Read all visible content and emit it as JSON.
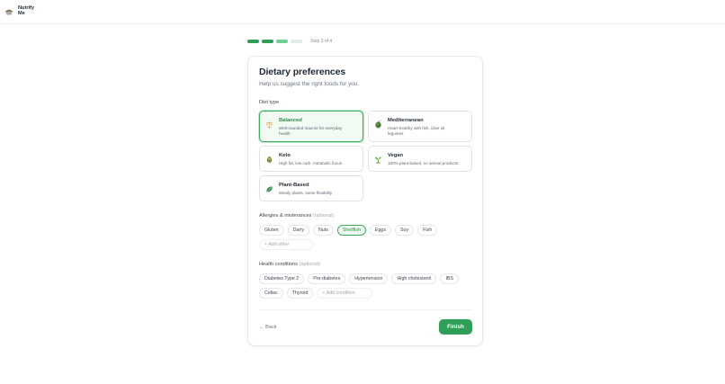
{
  "app": {
    "name_line1": "Nutrify",
    "name_line2": "Me",
    "logo_icon": "bowl-icon"
  },
  "progress": {
    "current_step": 3,
    "total_steps": 4,
    "label": "Step 3 of 4"
  },
  "card": {
    "title": "Dietary preferences",
    "subtitle": "Help us suggest the right foods for you."
  },
  "diet_section": {
    "label": "Diet type",
    "options": [
      {
        "name": "Balanced",
        "desc_line1": "Well-rounded macros for everyday",
        "desc_line2": "health",
        "icon": "scale-icon",
        "selected": true
      },
      {
        "name": "Mediterranean",
        "desc_line1": "Heart-healthy with fish, olive oil,",
        "desc_line2": "legumes",
        "icon": "olive-icon",
        "selected": false
      },
      {
        "name": "Keto",
        "desc_line1": "High fat, low carb, metabolic focus",
        "desc_line2": "",
        "icon": "avocado-icon",
        "selected": false
      },
      {
        "name": "Vegan",
        "desc_line1": "100% plant-based, no animal products",
        "desc_line2": "",
        "icon": "sprout-icon",
        "selected": false
      },
      {
        "name": "Plant-Based",
        "desc_line1": "Mostly plants, some flexibility",
        "desc_line2": "",
        "icon": "leaf-icon",
        "selected": false
      }
    ]
  },
  "allergies": {
    "label": "Allergies & intolerances",
    "optional": "(optional)",
    "chips": [
      "Gluten",
      "Dairy",
      "Nuts",
      "Shellfish",
      "Eggs",
      "Soy",
      "Fish"
    ],
    "selected": [
      "Shellfish"
    ],
    "add_placeholder": "+ Add other"
  },
  "conditions": {
    "label": "Health conditions",
    "optional": "(optional)",
    "chips": [
      "Diabetes Type 2",
      "Pre-diabetes",
      "Hypertension",
      "High cholesterol",
      "IBS",
      "Celiac",
      "Thyroid"
    ],
    "add_placeholder": "+ Add condition"
  },
  "footer": {
    "back_label": "← Back",
    "finish_label": "Finish"
  },
  "colors": {
    "accent": "#2f9e57",
    "accent_light": "#6fd191",
    "selected_bg": "#f1faf3",
    "border": "#e4e7eb"
  }
}
